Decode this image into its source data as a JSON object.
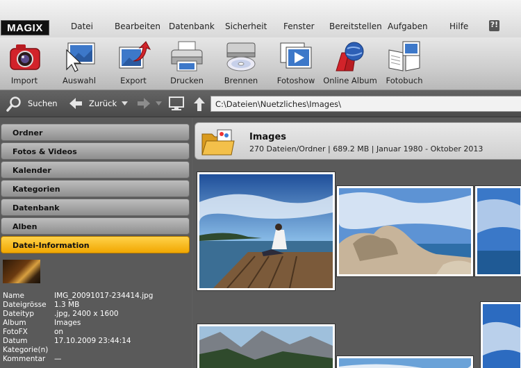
{
  "app": {
    "logo": "MAGIX"
  },
  "menu": {
    "items": [
      "Datei",
      "Bearbeiten",
      "Datenbank",
      "Sicherheit",
      "Fenster",
      "Bereitstellen",
      "Aufgaben",
      "Hilfe"
    ]
  },
  "toolbar": {
    "tools": [
      {
        "label": "Import",
        "icon": "camera-icon"
      },
      {
        "label": "Auswahl",
        "icon": "selection-icon"
      },
      {
        "label": "Export",
        "icon": "export-icon"
      },
      {
        "label": "Drucken",
        "icon": "printer-icon"
      },
      {
        "label": "Brennen",
        "icon": "burn-disc-icon"
      },
      {
        "label": "Fotoshow",
        "icon": "slideshow-icon"
      },
      {
        "label": "Online Album",
        "icon": "online-album-icon"
      },
      {
        "label": "Fotobuch",
        "icon": "photobook-icon"
      }
    ]
  },
  "nav": {
    "search_label": "Suchen",
    "back_label": "Zurück",
    "path": "C:\\Dateien\\Nuetzliches\\Images\\"
  },
  "sidebar": {
    "sections": [
      "Ordner",
      "Fotos & Videos",
      "Kalender",
      "Kategorien",
      "Datenbank",
      "Alben",
      "Datei-Information"
    ],
    "active_index": 6,
    "file_info": [
      {
        "label": "Name",
        "value": "IMG_20091017-234414.jpg"
      },
      {
        "label": "Dateigrösse",
        "value": "1.3 MB"
      },
      {
        "label": "Dateityp",
        "value": ".jpg, 2400 x 1600"
      },
      {
        "label": "Album",
        "value": "Images"
      },
      {
        "label": "FotoFX",
        "value": "on"
      },
      {
        "label": "Datum",
        "value": "17.10.2009 23:44:14"
      },
      {
        "label": "Kategorie(n)",
        "value": ""
      },
      {
        "label": "Kommentar",
        "value": "—"
      }
    ]
  },
  "folder": {
    "title": "Images",
    "summary": "270 Dateien/Ordner | 689.2 MB | Januar 1980 - Oktober 2013"
  },
  "colors": {
    "active_section": "#f5b400",
    "background": "#5a5a5a"
  }
}
